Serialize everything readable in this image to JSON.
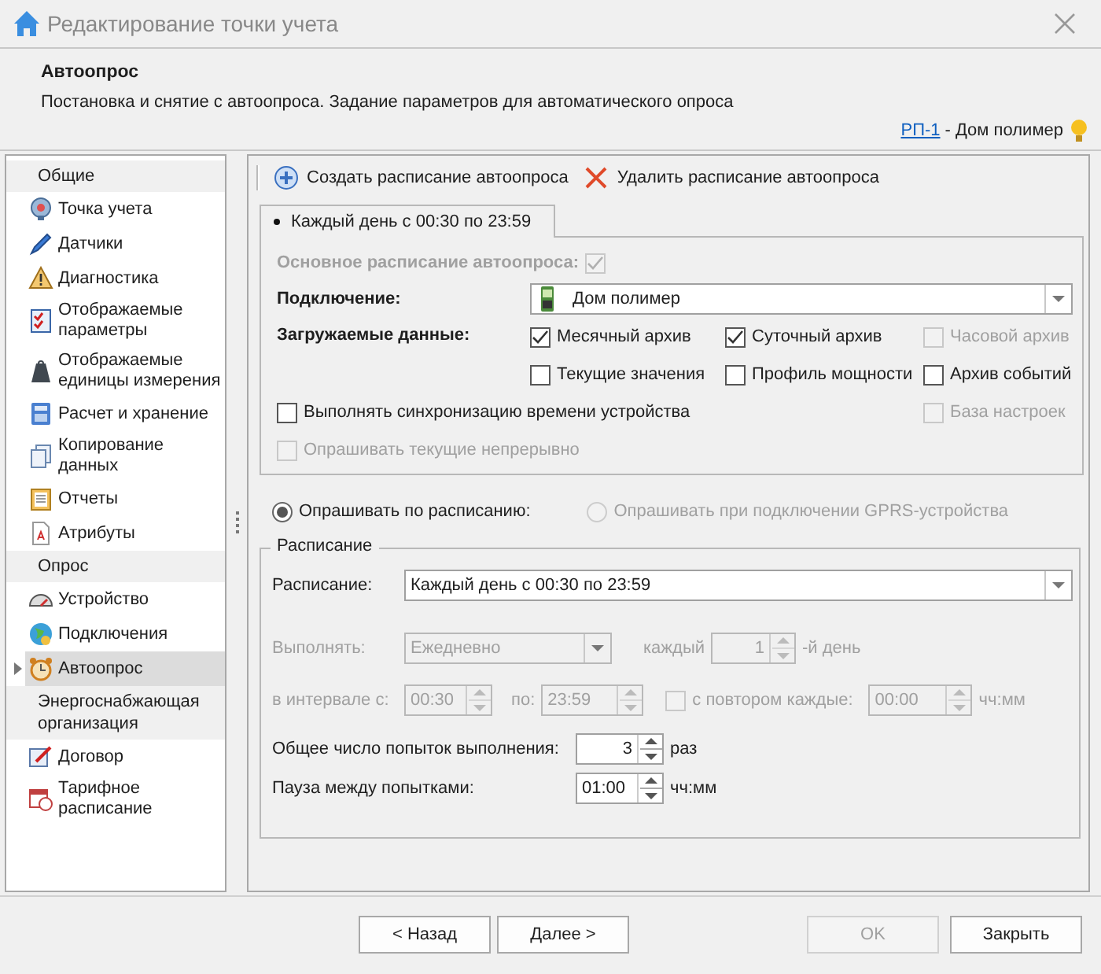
{
  "window": {
    "title": "Редактирование точки учета"
  },
  "header": {
    "title": "Автоопрос",
    "description": "Постановка и снятие с автоопроса. Задание параметров для автоматического опроса",
    "link": "РП-1",
    "object": "- Дом полимер"
  },
  "sidebar": {
    "groups": [
      {
        "label": "Общие",
        "items": [
          {
            "label": "Точка учета",
            "selected": false
          },
          {
            "label": "Датчики",
            "selected": false
          },
          {
            "label": "Диагностика",
            "selected": false
          },
          {
            "label": "Отображаемые параметры",
            "selected": false
          },
          {
            "label": "Отображаемые единицы измерения",
            "selected": false
          },
          {
            "label": "Расчет и хранение",
            "selected": false
          },
          {
            "label": "Копирование данных",
            "selected": false
          },
          {
            "label": "Отчеты",
            "selected": false
          },
          {
            "label": "Атрибуты",
            "selected": false
          }
        ]
      },
      {
        "label": "Опрос",
        "items": [
          {
            "label": "Устройство",
            "selected": false
          },
          {
            "label": "Подключения",
            "selected": false
          },
          {
            "label": "Автоопрос",
            "selected": true
          }
        ]
      },
      {
        "label": "Энергоснабжающая организация",
        "items": [
          {
            "label": "Договор",
            "selected": false
          },
          {
            "label": "Тарифное расписание",
            "selected": false
          }
        ]
      }
    ]
  },
  "toolbar": [
    {
      "label": "Создать расписание автоопроса"
    },
    {
      "label": "Удалить расписание автоопроса"
    }
  ],
  "tabs": [
    {
      "label": "Каждый день с 00:30 по 23:59",
      "selected": true
    }
  ],
  "options": {
    "main_schedule": {
      "label": "Основное расписание автоопроса:",
      "checked": true,
      "disabled": true
    },
    "connection": {
      "label": "Подключение:",
      "value": "Дом полимер"
    },
    "loaded_data": {
      "label": "Загружаемые данные:",
      "items": [
        {
          "label": "Месячный архив",
          "checked": true,
          "disabled": false
        },
        {
          "label": "Суточный архив",
          "checked": true,
          "disabled": false
        },
        {
          "label": "Часовой архив",
          "checked": false,
          "disabled": true
        },
        {
          "label": "Текущие значения",
          "checked": false,
          "disabled": false
        },
        {
          "label": "Профиль мощности",
          "checked": false,
          "disabled": false
        },
        {
          "label": "Архив событий",
          "checked": false,
          "disabled": false
        }
      ]
    },
    "sync_time": {
      "label": "Выполнять синхронизацию времени устройства",
      "checked": false,
      "disabled": false
    },
    "settings_base": {
      "label": "База настроек",
      "checked": false,
      "disabled": true
    },
    "poll_current": {
      "label": "Опрашивать текущие непрерывно",
      "checked": false,
      "disabled": true
    }
  },
  "poll_mode": [
    {
      "label": "Опрашивать по расписанию:",
      "selected": true,
      "disabled": false
    },
    {
      "label": "Опрашивать при подключении GPRS-устройства",
      "selected": false,
      "disabled": true
    }
  ],
  "schedule_group": {
    "title": "Расписание",
    "schedule": {
      "label": "Расписание:",
      "value": "Каждый день с 00:30 по 23:59"
    },
    "execute": {
      "label": "Выполнять:",
      "value": "Ежедневно",
      "disabled": true
    },
    "every": {
      "label": "каждый",
      "value": "1",
      "suffix": "-й день",
      "disabled": true
    },
    "interval_from": {
      "label": "в интервале с:",
      "value": "00:30",
      "disabled": true
    },
    "interval_to": {
      "label": "по:",
      "value": "23:59",
      "disabled": true
    },
    "repeat": {
      "label": "с повтором каждые:",
      "checked": false,
      "value": "00:00",
      "suffix": "чч:мм",
      "disabled": true
    },
    "attempts": {
      "label": "Общее число попыток выполнения:",
      "value": "3",
      "suffix": "раз",
      "disabled": false
    },
    "pause": {
      "label": "Пауза между попытками:",
      "value": "01:00",
      "suffix": "чч:мм",
      "disabled": false
    }
  },
  "footer": [
    {
      "label": "< Назад",
      "disabled": false
    },
    {
      "label": "Далее >",
      "disabled": false
    },
    {
      "label": "OK",
      "disabled": true
    },
    {
      "label": "Закрыть",
      "disabled": false
    }
  ]
}
